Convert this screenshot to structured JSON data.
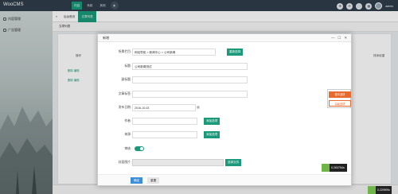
{
  "app": {
    "brand": "WooCMS",
    "admin": "admin"
  },
  "topnav": [
    {
      "label": "内容"
    },
    {
      "label": "系统"
    },
    {
      "label": "其他"
    }
  ],
  "sidebar": {
    "items": [
      {
        "label": "内容管理"
      },
      {
        "label": "广告管理"
      }
    ]
  },
  "tabs": [
    {
      "label": "后台首页"
    },
    {
      "label": "文章列表"
    }
  ],
  "background": {
    "section_title": "文章列表",
    "col_action": "操作",
    "col_order": "排序权重",
    "row_actions": "删除 编辑"
  },
  "modal": {
    "title": "新增",
    "fields": {
      "category_label": "所属栏目:",
      "category_value": "网站导航 > 新闻中心 > 公司新闻",
      "category_button": "重新选择",
      "title_label": "标题:",
      "title_value": "公司新闻测试",
      "subtitle_label": "副标题:",
      "subtitle_value": "",
      "tag_label": "文章标签:",
      "tag_value": "",
      "date_label": "发布日期:",
      "date_value": "2016-10-03",
      "author_label": "作者:",
      "author_value": "",
      "author_button": "添加选项",
      "source_label": "来源:",
      "source_value": "",
      "source_button": "添加选项",
      "audit_label": "审核:",
      "cover_label": "封面图片:",
      "cover_value": "",
      "cover_button": "选择文件"
    },
    "footer": {
      "confirm": "确定",
      "reset": "重置"
    }
  },
  "popover": {
    "item1": "基本选项",
    "item2": "高级选项"
  },
  "widgets": {
    "counter1": "0.263754s",
    "counter2": "0.220909s"
  },
  "colors": {
    "accent": "#1a9a7a",
    "topbar": "#2f3d4a",
    "primary": "#3b8fd8",
    "warning": "#e86a2d"
  }
}
